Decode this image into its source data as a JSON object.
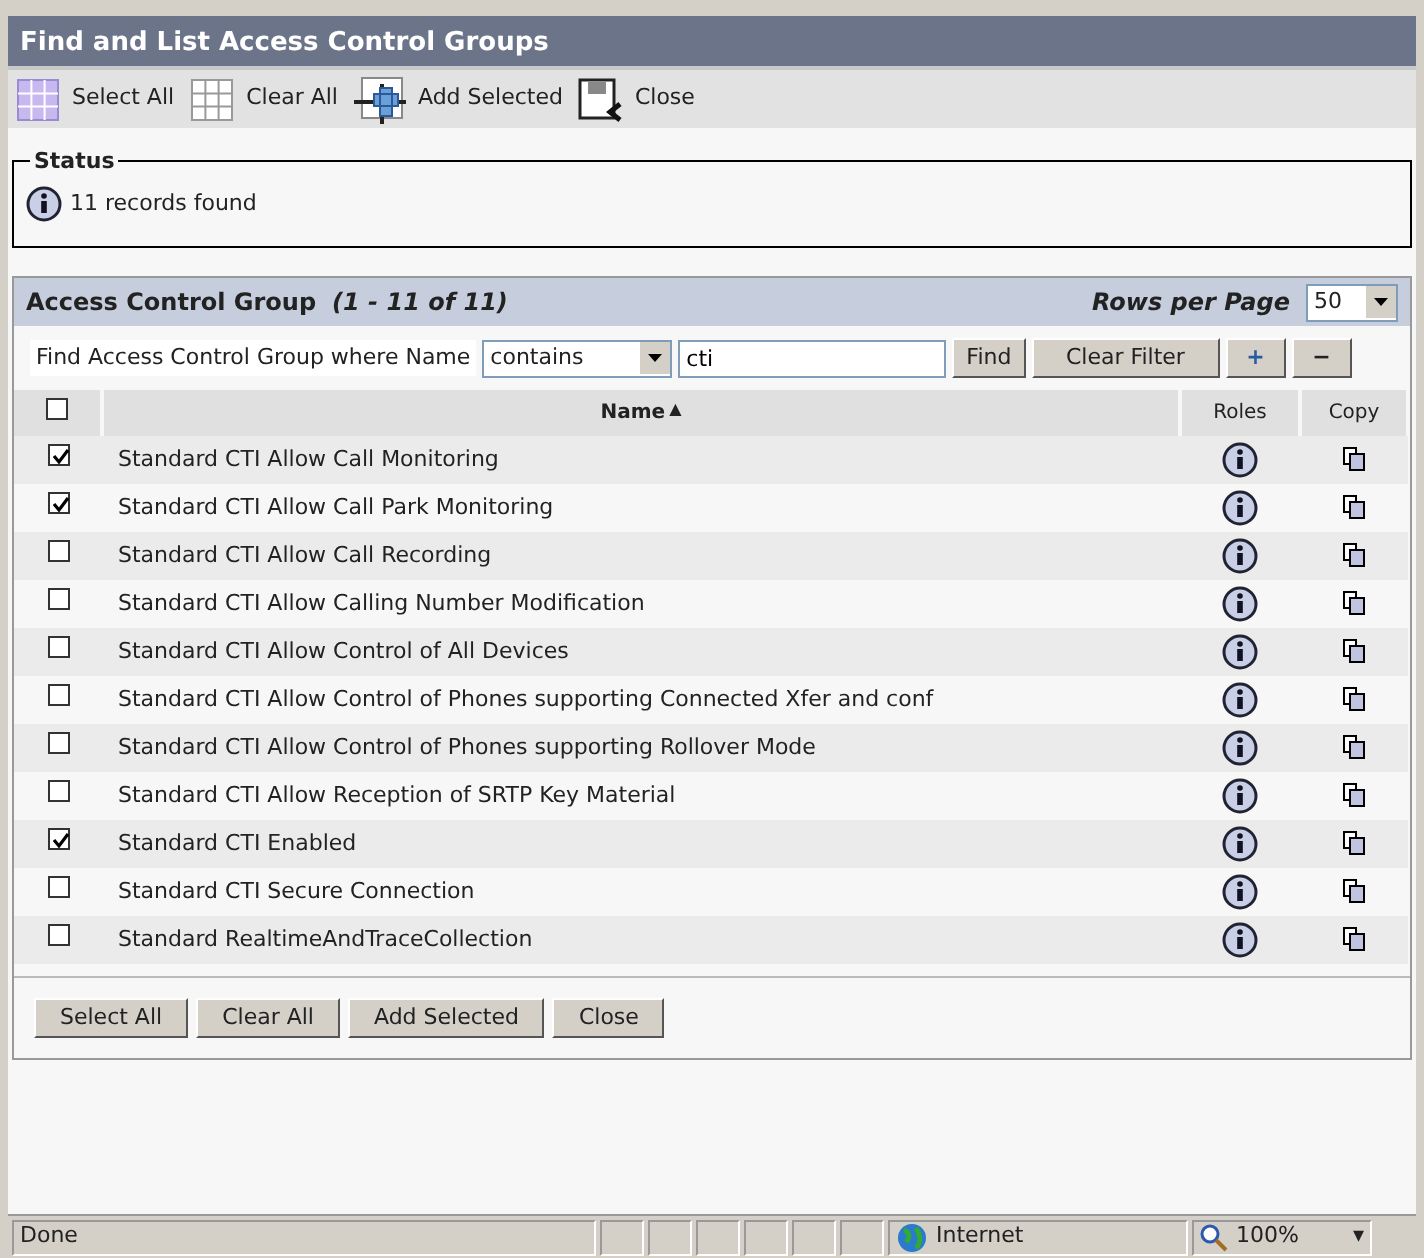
{
  "window": {
    "title": "Find and List Access Control Groups"
  },
  "toolbar": [
    {
      "kind": "select",
      "label": "Select All"
    },
    {
      "kind": "clear",
      "label": "Clear All"
    },
    {
      "kind": "add",
      "label": "Add Selected"
    },
    {
      "kind": "close",
      "label": "Close"
    }
  ],
  "status": {
    "legend": "Status",
    "message": "11 records found"
  },
  "panel": {
    "title": "Access Control Group",
    "range": "(1 - 11 of 11)",
    "rows_per_page_label": "Rows per Page",
    "rows_per_page": "50"
  },
  "filter": {
    "label": "Find Access Control Group where Name",
    "operator": "contains",
    "value": "cti",
    "find": "Find",
    "clear": "Clear Filter",
    "add": "+",
    "remove": "−"
  },
  "table": {
    "select_all_checked": false,
    "columns": [
      {
        "label": "Name",
        "sort": "▲"
      },
      {
        "label": "Roles"
      },
      {
        "label": "Copy"
      }
    ],
    "rows": [
      {
        "name": "Standard CTI Allow Call Monitoring",
        "checked": true
      },
      {
        "name": "Standard CTI Allow Call Park Monitoring",
        "checked": true
      },
      {
        "name": "Standard CTI Allow Call Recording",
        "checked": false
      },
      {
        "name": "Standard CTI Allow Calling Number Modification",
        "checked": false
      },
      {
        "name": "Standard CTI Allow Control of All Devices",
        "checked": false
      },
      {
        "name": "Standard CTI Allow Control of Phones supporting Connected Xfer and conf",
        "checked": false
      },
      {
        "name": "Standard CTI Allow Control of Phones supporting Rollover Mode",
        "checked": false
      },
      {
        "name": "Standard CTI Allow Reception of SRTP Key Material",
        "checked": false
      },
      {
        "name": "Standard CTI Enabled",
        "checked": true
      },
      {
        "name": "Standard CTI Secure Connection",
        "checked": false
      },
      {
        "name": "Standard RealtimeAndTraceCollection",
        "checked": false
      }
    ]
  },
  "bottom_buttons": [
    "Select All",
    "Clear All",
    "Add Selected",
    "Close"
  ],
  "status_bar": {
    "text": "Done",
    "zone": "Internet",
    "zoom": "100%",
    "zoom_caret": "▾"
  }
}
